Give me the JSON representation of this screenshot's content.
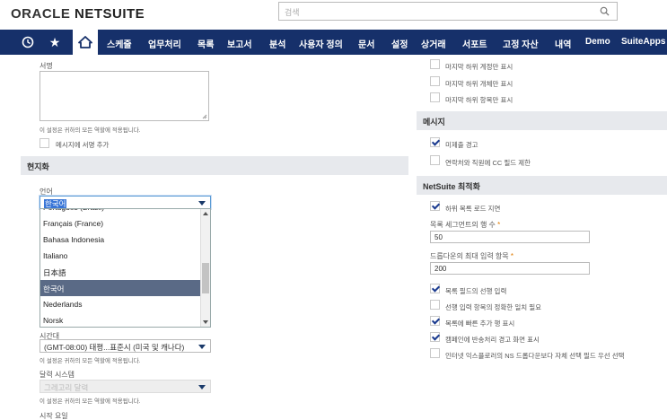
{
  "header": {
    "logo_light": "ORACLE ",
    "logo_bold": "NETSUITE",
    "search_placeholder": "검색"
  },
  "nav": {
    "items": [
      "스케줄",
      "업무처리",
      "목록",
      "보고서",
      "분석",
      "사용자 정의",
      "문서",
      "설정",
      "상거래",
      "서포트",
      "고정 자산",
      "내역",
      "Demo",
      "SuiteApps"
    ]
  },
  "left": {
    "signature_label": "서명",
    "signature_help": "이 설정은 귀하의 모든 역할에 적용됩니다.",
    "signature_cb": "메시지에 서명 추가",
    "localization_header": "현지화",
    "language_label": "언어",
    "language_value": "한국어",
    "language_partial_top": "Português (Brasil)",
    "language_options": [
      "Français (France)",
      "Bahasa Indonesia",
      "Italiano",
      "日本語",
      "한국어",
      "Nederlands",
      "Norsk"
    ],
    "timezone_label": "시간대",
    "timezone_value": "(GMT-08:00) 태평...표준시 (미국 및 캐나다)",
    "timezone_help": "이 설정은 귀하의 모든 역할에 적용됩니다.",
    "calendar_label": "달력 시스템",
    "calendar_value": "그레고리 달력",
    "calendar_help": "이 설정은 귀하의 모든 역할에 적용됩니다.",
    "start_day_label": "시작 요일"
  },
  "right": {
    "top_cbs": [
      "마지막 하위 계정만 표시",
      "마지막 하위 개체만 표시",
      "마지막 하위 항목만 표시"
    ],
    "message_header": "메시지",
    "message_cbs": [
      {
        "label": "미제출 경고",
        "checked": true
      },
      {
        "label": "연락처와 직원에 CC 필드 제한",
        "checked": false
      }
    ],
    "opt_header": "NetSuite 최적화",
    "opt_cb1": "하위 목록 로드 지연",
    "segment_label": "목록 세그먼트의 행 수",
    "segment_value": "50",
    "dropdown_max_label": "드롭다운의 최대 입력 항목",
    "dropdown_max_value": "200",
    "opt_cbs": [
      {
        "label": "목록 필드의 선행 입력",
        "checked": true
      },
      {
        "label": "선행 입력 항목의 정확한 일치 필요",
        "checked": false
      },
      {
        "label": "목록에 빠른 추가 행 표시",
        "checked": true
      },
      {
        "label": "캠페인에 반송처리 경고 화면 표시",
        "checked": true
      },
      {
        "label": "인터넷 익스플로러의 NS 드롭다운보다 자체 선택 필드 우선 선택",
        "checked": false
      }
    ],
    "required_mark": "*"
  }
}
